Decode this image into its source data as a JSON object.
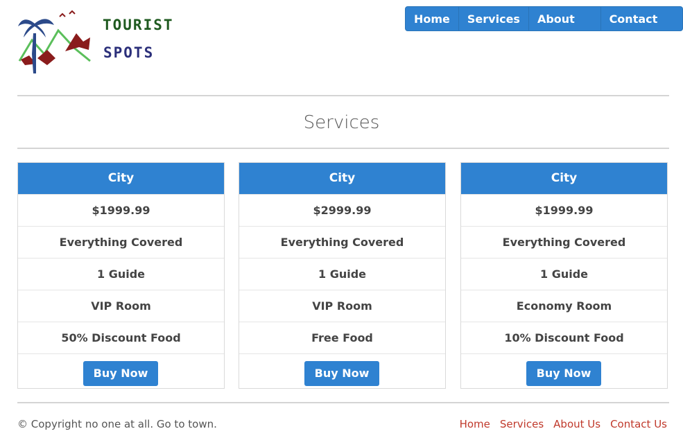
{
  "header": {
    "logo_text_line1": "TOURIST",
    "logo_text_line2": "SPOTS"
  },
  "nav": {
    "items": [
      "Home",
      "Services",
      "About US",
      "Contact US"
    ]
  },
  "services": {
    "title": "Services",
    "cards": [
      {
        "title": "City",
        "price": "$1999.99",
        "coverage": "Everything Covered",
        "guides": "1 Guide",
        "room": "VIP Room",
        "food": "50% Discount Food",
        "button": "Buy Now"
      },
      {
        "title": "City",
        "price": "$2999.99",
        "coverage": "Everything Covered",
        "guides": "1 Guide",
        "room": "VIP Room",
        "food": "Free Food",
        "button": "Buy Now"
      },
      {
        "title": "City",
        "price": "$1999.99",
        "coverage": "Everything Covered",
        "guides": "1 Guide",
        "room": "Economy Room",
        "food": "10% Discount Food",
        "button": "Buy Now"
      }
    ]
  },
  "footer": {
    "copyright": "© Copyright no one at all. Go to town.",
    "links": [
      "Home",
      "Services",
      "About Us",
      "Contact Us"
    ]
  },
  "colors": {
    "primary": "#2f82d1",
    "footer_link": "#c0392b",
    "divider": "#d4d4d4"
  }
}
